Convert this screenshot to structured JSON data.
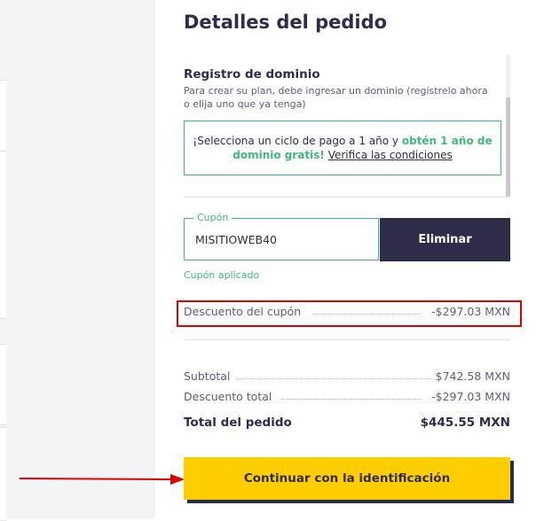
{
  "order": {
    "title": "Detalles del pedido",
    "domain_section": {
      "title": "Registro de dominio",
      "description": "Para crear su plan, debe ingresar un dominio (regístrelo ahora o elija uno que ya tenga)",
      "promo_text_before": "¡Selecciona un ciclo de pago a 1 año y ",
      "promo_bold": "obtén 1 año de dominio gratis!",
      "promo_link": "Verifica las condiciones"
    },
    "coupon": {
      "label": "Cupón",
      "value": "MISITIOWEB40",
      "remove_label": "Eliminar",
      "applied_text": "Cupón aplicado"
    },
    "coupon_discount": {
      "label": "Descuento del cupón",
      "value": "-$297.03 MXN"
    },
    "summary": {
      "subtotal_label": "Subtotal",
      "subtotal_value": "$742.58 MXN",
      "discount_label": "Descuento total",
      "discount_value": "-$297.03 MXN",
      "total_label": "Total del pedido",
      "total_value": "$445.55 MXN"
    },
    "continue_label": "Continuar con la identificación"
  },
  "colors": {
    "primary_dark": "#2d2d4a",
    "accent_green": "#3fb87d",
    "cta_yellow": "#ffcd00",
    "annotation_red": "#e00000"
  },
  "icons": {
    "annotation": "arrow-right-icon"
  }
}
